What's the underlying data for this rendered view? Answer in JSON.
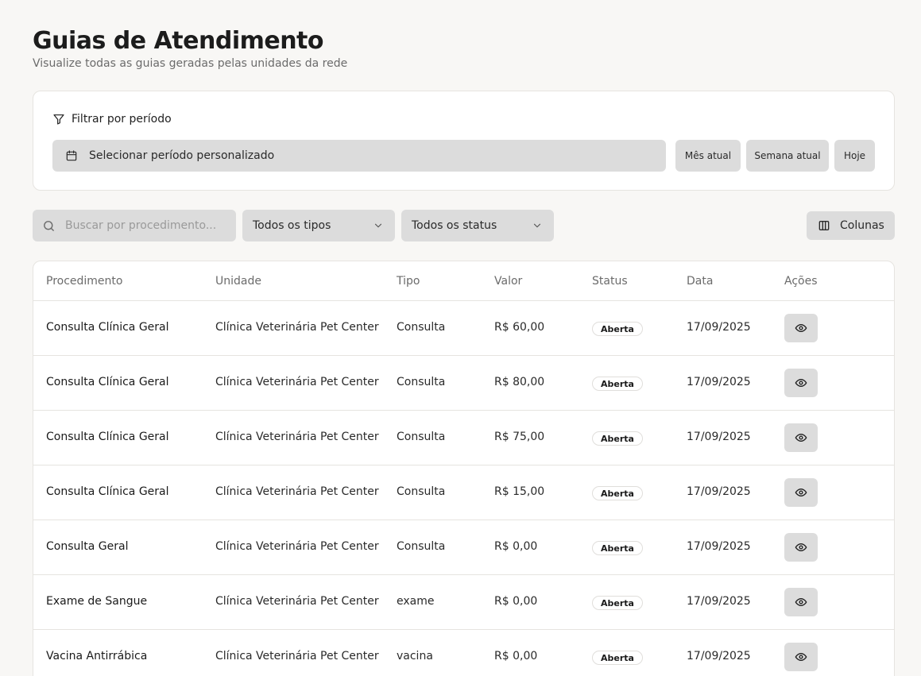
{
  "header": {
    "title": "Guias de Atendimento",
    "subtitle": "Visualize todas as guias geradas pelas unidades da rede"
  },
  "filter": {
    "heading": "Filtrar por período",
    "heading_icon": "filter-icon",
    "period_placeholder": "Selecionar período personalizado",
    "period_icon": "calendar-icon",
    "quick_buttons": [
      "Mês atual",
      "Semana atual",
      "Hoje"
    ]
  },
  "toolbar": {
    "search_placeholder": "Buscar por procedimento...",
    "search_icon": "search-icon",
    "type_select": "Todos os tipos",
    "status_select": "Todos os status",
    "columns_label": "Colunas",
    "columns_icon": "columns-icon"
  },
  "table": {
    "columns": [
      "Procedimento",
      "Unidade",
      "Tipo",
      "Valor",
      "Status",
      "Data",
      "Ações"
    ],
    "rows": [
      {
        "procedimento": "Consulta Clínica Geral",
        "unidade": "Clínica Veterinária Pet Center",
        "tipo": "Consulta",
        "valor": "R$ 60,00",
        "status": "Aberta",
        "data": "17/09/2025"
      },
      {
        "procedimento": "Consulta Clínica Geral",
        "unidade": "Clínica Veterinária Pet Center",
        "tipo": "Consulta",
        "valor": "R$ 80,00",
        "status": "Aberta",
        "data": "17/09/2025"
      },
      {
        "procedimento": "Consulta Clínica Geral",
        "unidade": "Clínica Veterinária Pet Center",
        "tipo": "Consulta",
        "valor": "R$ 75,00",
        "status": "Aberta",
        "data": "17/09/2025"
      },
      {
        "procedimento": "Consulta Clínica Geral",
        "unidade": "Clínica Veterinária Pet Center",
        "tipo": "Consulta",
        "valor": "R$ 15,00",
        "status": "Aberta",
        "data": "17/09/2025"
      },
      {
        "procedimento": "Consulta Geral",
        "unidade": "Clínica Veterinária Pet Center",
        "tipo": "Consulta",
        "valor": "R$ 0,00",
        "status": "Aberta",
        "data": "17/09/2025"
      },
      {
        "procedimento": "Exame de Sangue",
        "unidade": "Clínica Veterinária Pet Center",
        "tipo": "exame",
        "valor": "R$ 0,00",
        "status": "Aberta",
        "data": "17/09/2025"
      },
      {
        "procedimento": "Vacina Antirrábica",
        "unidade": "Clínica Veterinária Pet Center",
        "tipo": "vacina",
        "valor": "R$ 0,00",
        "status": "Aberta",
        "data": "17/09/2025"
      }
    ],
    "action_icon": "eye-icon"
  },
  "colors": {
    "background": "#f8f7f5",
    "surface": "#ffffff",
    "control": "#dcdcdc",
    "border": "#e6e4e0",
    "text": "#1f1f1f",
    "muted_text": "#6b6b6b"
  }
}
